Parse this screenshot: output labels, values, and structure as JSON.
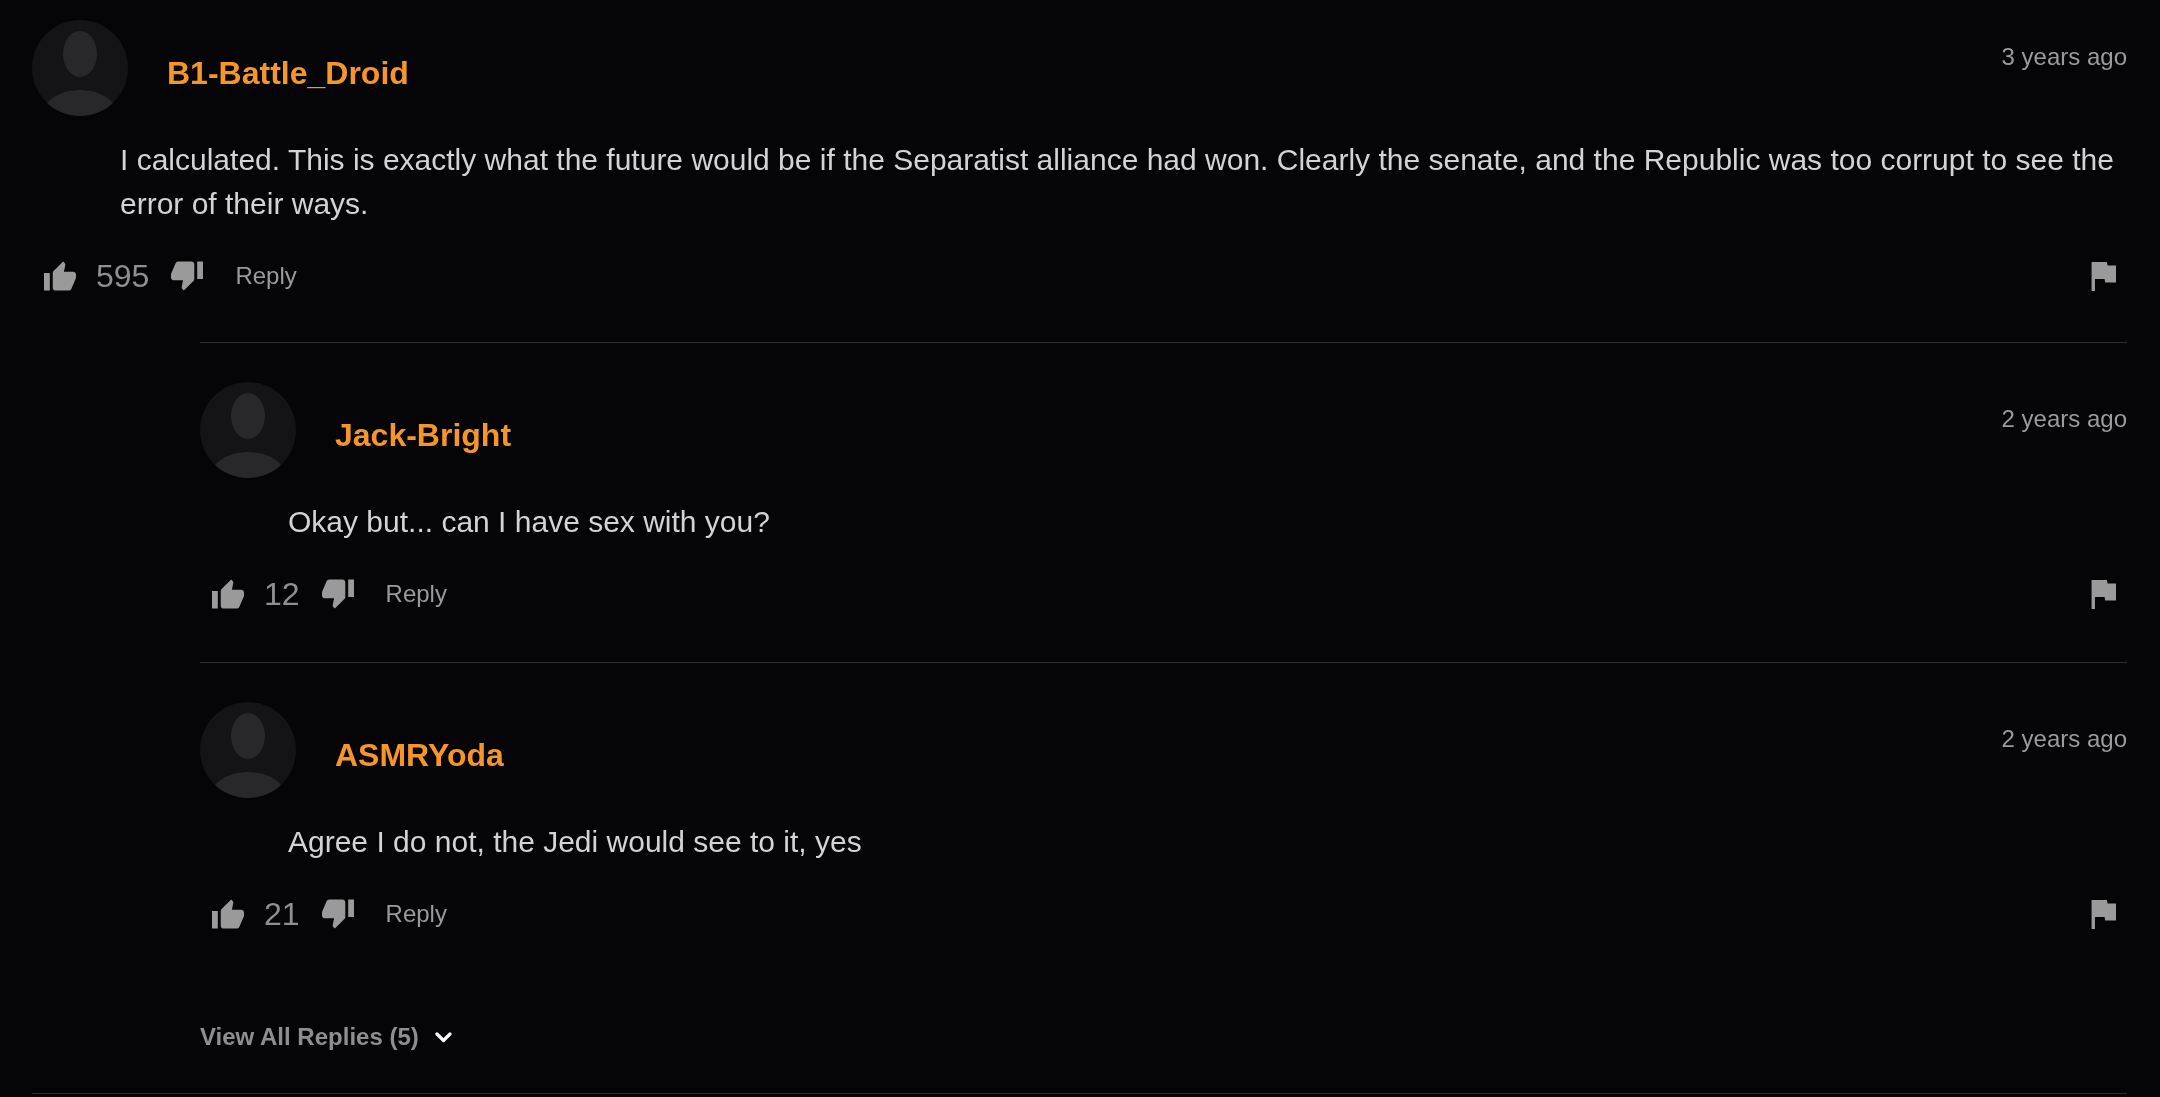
{
  "thread": {
    "author": "B1-Battle_Droid",
    "time": "3 years ago",
    "text": "I calculated. This is exactly what the future would be if the Separatist alliance had won. Clearly the senate, and the Republic was too corrupt to see the error of their ways.",
    "likes": "595",
    "reply_label": "Reply",
    "replies": [
      {
        "author": "Jack-Bright",
        "time": "2 years ago",
        "text": "Okay but... can I have sex with you?",
        "likes": "12",
        "reply_label": "Reply"
      },
      {
        "author": "ASMRYoda",
        "time": "2 years ago",
        "text": "Agree I do not, the Jedi would see to it, yes",
        "likes": "21",
        "reply_label": "Reply"
      }
    ],
    "view_all_replies": {
      "label": "View All Replies (5)",
      "expanded": false
    }
  }
}
